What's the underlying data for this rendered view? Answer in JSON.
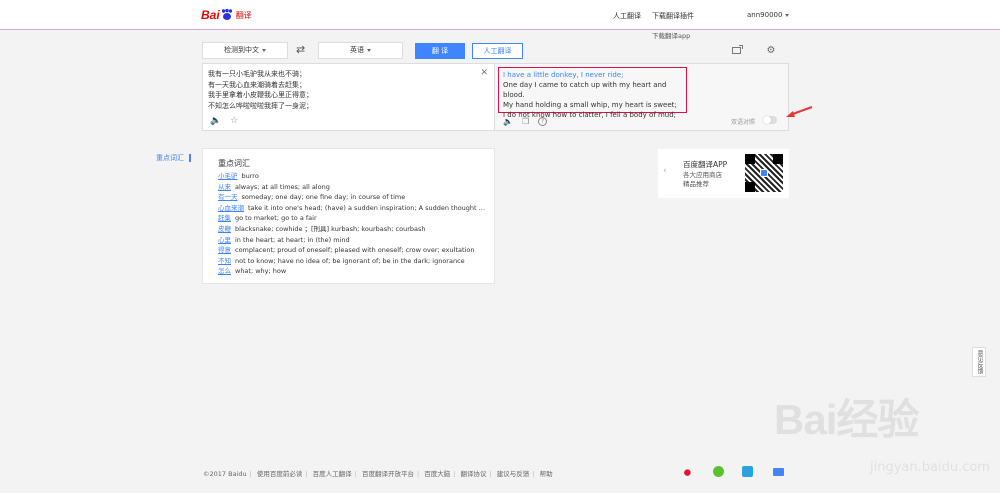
{
  "header": {
    "logo_bai": "Bai",
    "logo_fanyi": "翻译",
    "nav_human": "人工翻译",
    "nav_plugin": "下载翻译插件",
    "user": "ann90000",
    "app_download": "下载翻译app"
  },
  "toolbar": {
    "source_lang": "检测到中文",
    "target_lang": "英语",
    "swap_icon": "swap-arrows",
    "translate_label": "翻 译",
    "human_label": "人工翻译"
  },
  "source": {
    "lines": [
      "我有一只小毛驴我从来也不骑；",
      "有一天我心血来潮骑着去赶集；",
      "我手里拿着小皮鞭我心里正得意；",
      "不知怎么哗啦啦啦我摔了一身泥；"
    ]
  },
  "target": {
    "lines": [
      "I have a little donkey, I never ride;",
      "One day I came to catch up with my heart and blood.",
      "My hand holding a small whip, my heart is sweet;",
      "I do not know how to clatter, I fell a body of mud;"
    ],
    "compare_label": "双语对照"
  },
  "side_tab": "重点词汇",
  "vocab": {
    "title": "重点词汇",
    "items": [
      {
        "word": "小毛驴",
        "def": "burro"
      },
      {
        "word": "从来",
        "def": "always; at all times; all along"
      },
      {
        "word": "有一天",
        "def": "someday; one day; one fine day; in course of time"
      },
      {
        "word": "心血来潮",
        "def": "take it into one's head; (have) a sudden inspiration; A sudden thought hit ..."
      },
      {
        "word": "赶集",
        "def": "go to market; go to a fair"
      },
      {
        "word": "皮鞭",
        "def": "blacksnake; cowhide ；[刑具] kurbash; kourbash; courbash"
      },
      {
        "word": "心里",
        "def": "in the heart; at heart; in (the) mind"
      },
      {
        "word": "得意",
        "def": "complacent; proud of oneself; pleased with oneself; crow over; exultation"
      },
      {
        "word": "不知",
        "def": "not to know; have no idea of; be ignorant of; be in the dark; ignorance"
      },
      {
        "word": "怎么",
        "def": "what; why; how"
      }
    ]
  },
  "app_promo": {
    "name": "百度翻译APP",
    "line1": "各大应用商店",
    "line2": "精品推荐"
  },
  "feedback": "意见反馈",
  "watermark": {
    "text": "Bai经验",
    "url": "jingyan.baidu.com"
  },
  "footer": {
    "items": [
      "©2017 Baidu",
      "使用百度前必读",
      "百度人工翻译",
      "百度翻译开放平台",
      "百度大脑",
      "翻译协议",
      "建议与反馈",
      "帮助"
    ]
  }
}
